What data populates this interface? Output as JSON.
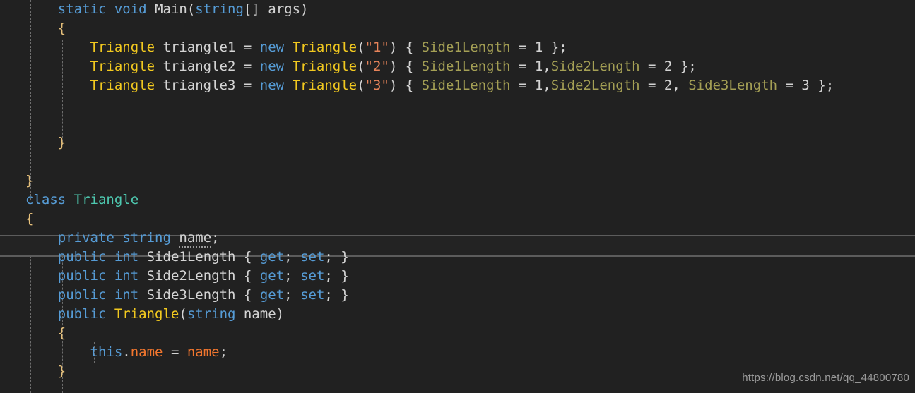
{
  "editor": {
    "language": "csharp",
    "background_color": "#212121",
    "current_line_number": 14,
    "colors": {
      "keyword": "#569cd6",
      "type": "#f2c91f",
      "class_name": "#4ec9b0",
      "plain": "#d4d4d4",
      "string": "#e8845a",
      "property": "#a5a055",
      "field": "#f2762e",
      "current_line_bg": "#232323",
      "current_line_border": "#5c5c5c",
      "indent_guide": "#6e6e6e",
      "watermark": "#9c9c9c"
    }
  },
  "code": {
    "lines": [
      {
        "indent": "    ",
        "tokens": [
          {
            "t": "static",
            "c": "kw"
          },
          {
            "t": " ",
            "c": "pln"
          },
          {
            "t": "void",
            "c": "kw"
          },
          {
            "t": " ",
            "c": "pln"
          },
          {
            "t": "Main",
            "c": "pln"
          },
          {
            "t": "(",
            "c": "brc"
          },
          {
            "t": "string",
            "c": "kw"
          },
          {
            "t": "[]",
            "c": "brc"
          },
          {
            "t": " args",
            "c": "pln"
          },
          {
            "t": ")",
            "c": "brc"
          }
        ]
      },
      {
        "indent": "    ",
        "tokens": [
          {
            "t": "{",
            "c": "brc-y"
          }
        ]
      },
      {
        "indent": "        ",
        "tokens": [
          {
            "t": "Triangle",
            "c": "typ"
          },
          {
            "t": " triangle1 ",
            "c": "pln"
          },
          {
            "t": "=",
            "c": "pln"
          },
          {
            "t": " ",
            "c": "pln"
          },
          {
            "t": "new",
            "c": "kw"
          },
          {
            "t": " ",
            "c": "pln"
          },
          {
            "t": "Triangle",
            "c": "typ"
          },
          {
            "t": "(",
            "c": "brc"
          },
          {
            "t": "\"1\"",
            "c": "str"
          },
          {
            "t": ")",
            "c": "brc"
          },
          {
            "t": " ",
            "c": "pln"
          },
          {
            "t": "{",
            "c": "brc"
          },
          {
            "t": " ",
            "c": "pln"
          },
          {
            "t": "Side1Length",
            "c": "prop"
          },
          {
            "t": " = 1 ",
            "c": "pln"
          },
          {
            "t": "}",
            "c": "brc"
          },
          {
            "t": ";",
            "c": "pln"
          }
        ]
      },
      {
        "indent": "        ",
        "tokens": [
          {
            "t": "Triangle",
            "c": "typ"
          },
          {
            "t": " triangle2 ",
            "c": "pln"
          },
          {
            "t": "=",
            "c": "pln"
          },
          {
            "t": " ",
            "c": "pln"
          },
          {
            "t": "new",
            "c": "kw"
          },
          {
            "t": " ",
            "c": "pln"
          },
          {
            "t": "Triangle",
            "c": "typ"
          },
          {
            "t": "(",
            "c": "brc"
          },
          {
            "t": "\"2\"",
            "c": "str"
          },
          {
            "t": ")",
            "c": "brc"
          },
          {
            "t": " ",
            "c": "pln"
          },
          {
            "t": "{",
            "c": "brc"
          },
          {
            "t": " ",
            "c": "pln"
          },
          {
            "t": "Side1Length",
            "c": "prop"
          },
          {
            "t": " = 1,",
            "c": "pln"
          },
          {
            "t": "Side2Length",
            "c": "prop"
          },
          {
            "t": " = 2 ",
            "c": "pln"
          },
          {
            "t": "}",
            "c": "brc"
          },
          {
            "t": ";",
            "c": "pln"
          }
        ]
      },
      {
        "indent": "        ",
        "tokens": [
          {
            "t": "Triangle",
            "c": "typ"
          },
          {
            "t": " triangle3 ",
            "c": "pln"
          },
          {
            "t": "=",
            "c": "pln"
          },
          {
            "t": " ",
            "c": "pln"
          },
          {
            "t": "new",
            "c": "kw"
          },
          {
            "t": " ",
            "c": "pln"
          },
          {
            "t": "Triangle",
            "c": "typ"
          },
          {
            "t": "(",
            "c": "brc"
          },
          {
            "t": "\"3\"",
            "c": "str"
          },
          {
            "t": ")",
            "c": "brc"
          },
          {
            "t": " ",
            "c": "pln"
          },
          {
            "t": "{",
            "c": "brc"
          },
          {
            "t": " ",
            "c": "pln"
          },
          {
            "t": "Side1Length",
            "c": "prop"
          },
          {
            "t": " = 1,",
            "c": "pln"
          },
          {
            "t": "Side2Length",
            "c": "prop"
          },
          {
            "t": " = 2, ",
            "c": "pln"
          },
          {
            "t": "Side3Length",
            "c": "prop"
          },
          {
            "t": " = 3 ",
            "c": "pln"
          },
          {
            "t": "}",
            "c": "brc"
          },
          {
            "t": ";",
            "c": "pln"
          }
        ]
      },
      {
        "indent": "",
        "tokens": []
      },
      {
        "indent": "",
        "tokens": []
      },
      {
        "indent": "    ",
        "tokens": [
          {
            "t": "}",
            "c": "brc-y"
          }
        ]
      },
      {
        "indent": "",
        "tokens": []
      },
      {
        "indent": "",
        "tokens": [
          {
            "t": "}",
            "c": "brc-y"
          }
        ]
      },
      {
        "indent": "",
        "tokens": [
          {
            "t": "class",
            "c": "kw"
          },
          {
            "t": " ",
            "c": "pln"
          },
          {
            "t": "Triangle",
            "c": "cls"
          }
        ]
      },
      {
        "indent": "",
        "tokens": [
          {
            "t": "{",
            "c": "brc-y"
          }
        ]
      },
      {
        "indent": "    ",
        "current": true,
        "tokens": [
          {
            "t": "private",
            "c": "kw"
          },
          {
            "t": " ",
            "c": "pln"
          },
          {
            "t": "string",
            "c": "kw"
          },
          {
            "t": " ",
            "c": "pln"
          },
          {
            "t": "name",
            "c": "pln",
            "dots": true
          },
          {
            "t": ";",
            "c": "pln"
          }
        ]
      },
      {
        "indent": "    ",
        "tokens": [
          {
            "t": "public",
            "c": "kw"
          },
          {
            "t": " ",
            "c": "pln"
          },
          {
            "t": "int",
            "c": "kw"
          },
          {
            "t": " ",
            "c": "pln"
          },
          {
            "t": "Side1Length",
            "c": "pln"
          },
          {
            "t": " ",
            "c": "pln"
          },
          {
            "t": "{",
            "c": "brc"
          },
          {
            "t": " ",
            "c": "pln"
          },
          {
            "t": "get",
            "c": "kw"
          },
          {
            "t": "; ",
            "c": "pln"
          },
          {
            "t": "set",
            "c": "kw"
          },
          {
            "t": "; ",
            "c": "pln"
          },
          {
            "t": "}",
            "c": "brc"
          }
        ]
      },
      {
        "indent": "    ",
        "tokens": [
          {
            "t": "public",
            "c": "kw"
          },
          {
            "t": " ",
            "c": "pln"
          },
          {
            "t": "int",
            "c": "kw"
          },
          {
            "t": " ",
            "c": "pln"
          },
          {
            "t": "Side2Length",
            "c": "pln"
          },
          {
            "t": " ",
            "c": "pln"
          },
          {
            "t": "{",
            "c": "brc"
          },
          {
            "t": " ",
            "c": "pln"
          },
          {
            "t": "get",
            "c": "kw"
          },
          {
            "t": "; ",
            "c": "pln"
          },
          {
            "t": "set",
            "c": "kw"
          },
          {
            "t": "; ",
            "c": "pln"
          },
          {
            "t": "}",
            "c": "brc"
          }
        ]
      },
      {
        "indent": "    ",
        "tokens": [
          {
            "t": "public",
            "c": "kw"
          },
          {
            "t": " ",
            "c": "pln"
          },
          {
            "t": "int",
            "c": "kw"
          },
          {
            "t": " ",
            "c": "pln"
          },
          {
            "t": "Side3Length",
            "c": "pln"
          },
          {
            "t": " ",
            "c": "pln"
          },
          {
            "t": "{",
            "c": "brc"
          },
          {
            "t": " ",
            "c": "pln"
          },
          {
            "t": "get",
            "c": "kw"
          },
          {
            "t": "; ",
            "c": "pln"
          },
          {
            "t": "set",
            "c": "kw"
          },
          {
            "t": "; ",
            "c": "pln"
          },
          {
            "t": "}",
            "c": "brc"
          }
        ]
      },
      {
        "indent": "    ",
        "tokens": [
          {
            "t": "public",
            "c": "kw"
          },
          {
            "t": " ",
            "c": "pln"
          },
          {
            "t": "Triangle",
            "c": "typ"
          },
          {
            "t": "(",
            "c": "brc"
          },
          {
            "t": "string",
            "c": "kw"
          },
          {
            "t": " name",
            "c": "pln"
          },
          {
            "t": ")",
            "c": "brc"
          }
        ]
      },
      {
        "indent": "    ",
        "tokens": [
          {
            "t": "{",
            "c": "brc-y"
          }
        ]
      },
      {
        "indent": "        ",
        "tokens": [
          {
            "t": "this",
            "c": "kw"
          },
          {
            "t": ".",
            "c": "pln"
          },
          {
            "t": "name",
            "c": "fld"
          },
          {
            "t": " = ",
            "c": "pln"
          },
          {
            "t": "name",
            "c": "fld"
          },
          {
            "t": ";",
            "c": "pln"
          }
        ]
      },
      {
        "indent": "    ",
        "tokens": [
          {
            "t": "}",
            "c": "brc-y"
          }
        ]
      }
    ]
  },
  "watermark": {
    "text": "https://blog.csdn.net/qq_44800780"
  }
}
